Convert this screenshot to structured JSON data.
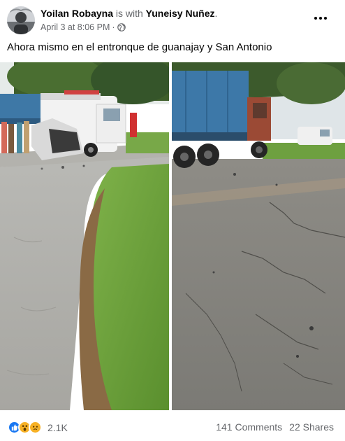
{
  "post": {
    "author": "Yoilan Robayna",
    "with_text": "is with",
    "tagged": "Yuneisy Nuñez",
    "tagged_suffix": ".",
    "date": "April 3 at 8:06 PM",
    "separator": "·",
    "privacy_icon": "globe-icon",
    "text": "Ahora mismo en el entronque de guanajay y San Antonio"
  },
  "photos": [
    {
      "name": "accident-van-photo",
      "description_icon": "photo"
    },
    {
      "name": "truck-road-photo",
      "description_icon": "photo"
    }
  ],
  "footer": {
    "reaction_icons": [
      "like-icon",
      "wow-icon",
      "sad-icon"
    ],
    "reaction_count": "2.1K",
    "comments": "141 Comments",
    "shares": "22 Shares"
  },
  "colors": {
    "text_primary": "#050505",
    "text_secondary": "#65676b",
    "like_blue": "#1877f2",
    "emoji_yellow": "#f7b125"
  }
}
